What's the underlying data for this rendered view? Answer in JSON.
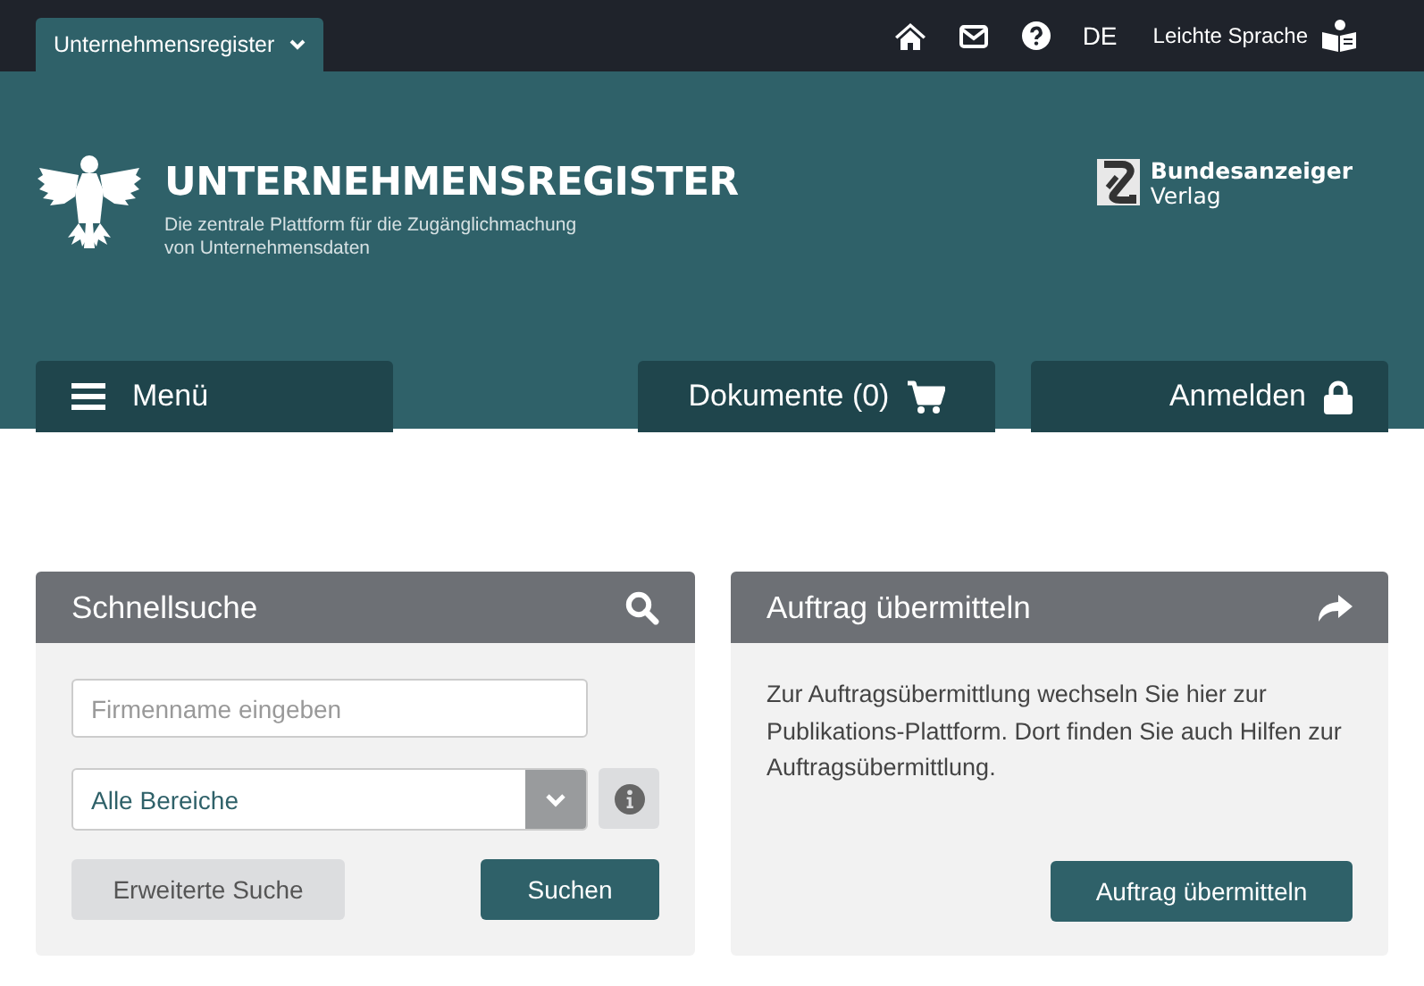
{
  "top_bar": {
    "portal_tab": {
      "label": "Unternehmensregister"
    },
    "language": "DE",
    "easy_language": "Leichte Sprache"
  },
  "header": {
    "title": "UNTERNEHMENSREGISTER",
    "subtitle_lines": [
      "Die zentrale Plattform für die Zugänglichmachung",
      "von Unternehmensdaten"
    ],
    "publisher": {
      "name": "Bundesanzeiger",
      "sub": "Verlag"
    }
  },
  "nav": {
    "menu": "Menü",
    "documents": "Dokumente (0)",
    "login": "Anmelden"
  },
  "quick_search": {
    "title": "Schnellsuche",
    "name_field": {
      "placeholder": "Firmenname eingeben"
    },
    "area_select": {
      "value": "Alle Bereiche"
    },
    "buttons": [
      {
        "label": "Erweiterte Suche",
        "kind": "secondary"
      },
      {
        "label": "Suchen",
        "kind": "primary"
      }
    ]
  },
  "order": {
    "title": "Auftrag übermitteln",
    "text": "Zur Auftragsübermittlung wechseln Sie hier zur Publikations-Plattform. Dort finden Sie auch Hilfen zur Auftragsübermittlung.",
    "button": "Auftrag übermitteln"
  }
}
